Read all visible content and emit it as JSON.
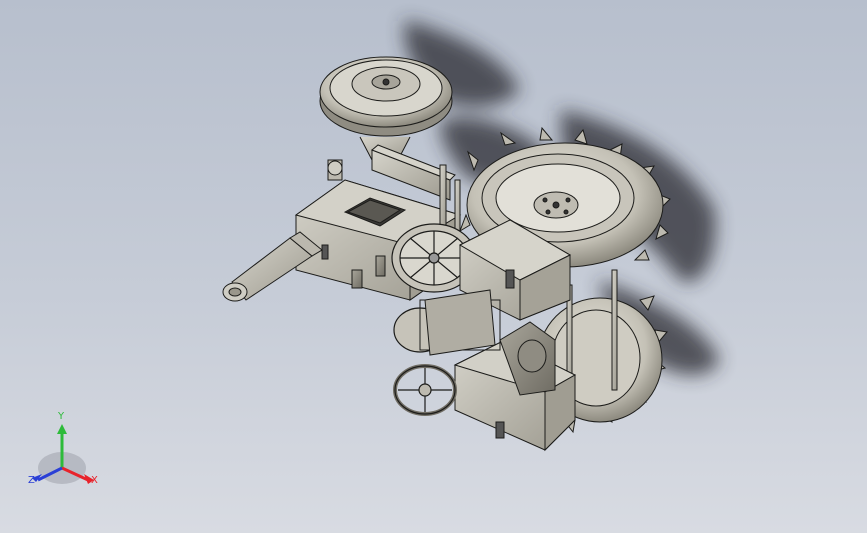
{
  "viewport": {
    "background_top": "#b7bfcd",
    "background_bottom": "#d8dbe2",
    "model_color": "#b7b5a9",
    "edge_color": "#1c1c1a"
  },
  "triad": {
    "x_label": "X",
    "y_label": "Y",
    "z_label": "Z",
    "x_color": "#e8232b",
    "y_color": "#2dbb3a",
    "z_color": "#2a3fd6"
  }
}
